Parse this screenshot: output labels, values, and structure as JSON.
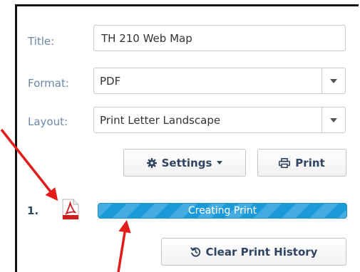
{
  "form": {
    "title_label": "Title:",
    "title_value": "TH 210 Web Map",
    "format_label": "Format:",
    "format_value": "PDF",
    "layout_label": "Layout:",
    "layout_value": "Print Letter Landscape"
  },
  "buttons": {
    "settings_label": "Settings",
    "print_label": "Print",
    "clear_history_label": "Clear Print History"
  },
  "print_job": {
    "index": "1.",
    "status": "Creating Print",
    "progress": 1.0
  },
  "icons": {
    "settings": "gear-icon",
    "settings_caret": "caret-down-icon",
    "print": "printer-icon",
    "file": "pdf-file-icon",
    "clear": "history-icon",
    "dropdown": "caret-down-icon"
  },
  "colors": {
    "label": "#6c87a8",
    "button_text": "#2e4461",
    "progress": "#1b9ad9",
    "annotation_arrow": "#e31b1b",
    "pdf_icon": "#cc1f1f"
  }
}
